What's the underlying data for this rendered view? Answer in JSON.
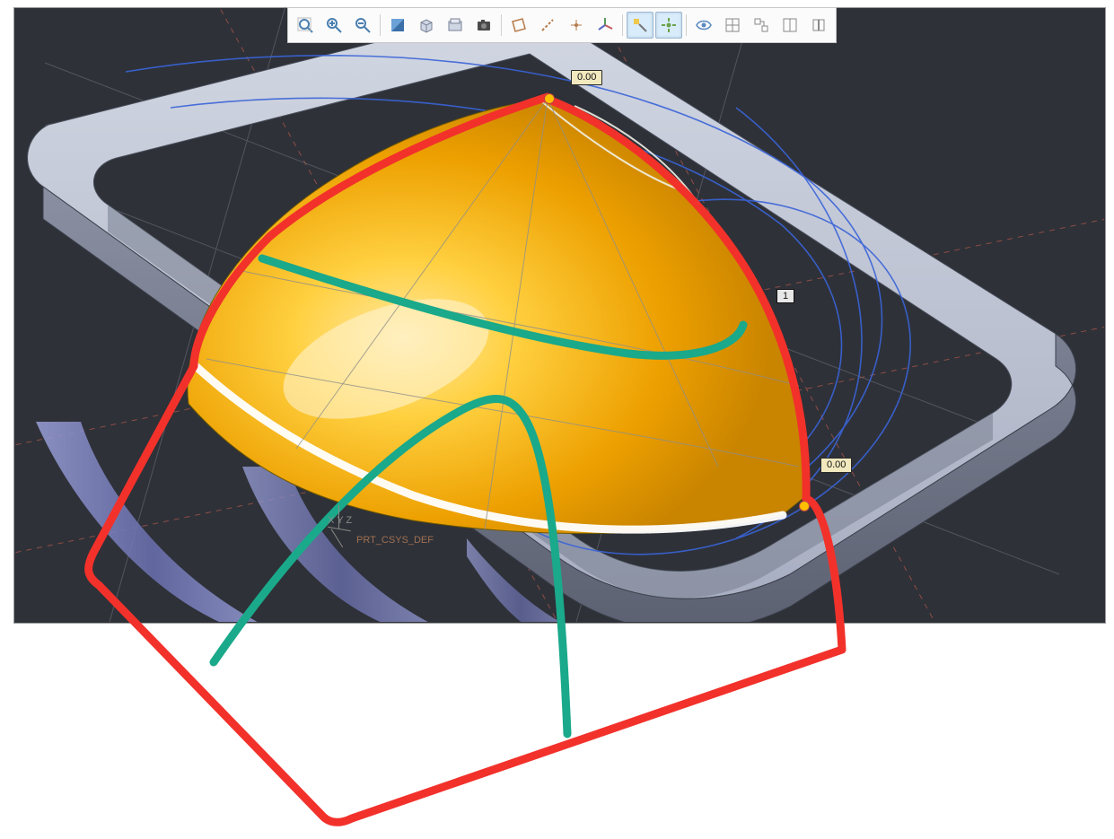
{
  "toolbar": {
    "buttons": [
      {
        "name": "refit",
        "tip": "Refit"
      },
      {
        "name": "zoom-in",
        "tip": "Zoom In"
      },
      {
        "name": "zoom-out",
        "tip": "Zoom Out"
      },
      {
        "name": "repaint",
        "tip": "Repaint"
      },
      {
        "name": "display-style",
        "tip": "Display Style"
      },
      {
        "name": "saved-views",
        "tip": "Saved Views"
      },
      {
        "name": "image-capture",
        "tip": "Render Region"
      },
      {
        "name": "datum-plane-display",
        "tip": "Datum Planes"
      },
      {
        "name": "datum-axis-display",
        "tip": "Datum Axes"
      },
      {
        "name": "datum-point-display",
        "tip": "Datum Points"
      },
      {
        "name": "csys-display",
        "tip": "Csys Display"
      },
      {
        "name": "annotation-display",
        "tip": "Annotations",
        "active": true
      },
      {
        "name": "spin-center",
        "tip": "Spin Center",
        "active": true
      },
      {
        "name": "perspective",
        "tip": "Perspective"
      },
      {
        "name": "layers",
        "tip": "Layers"
      },
      {
        "name": "model-tree",
        "tip": "Model Tree"
      },
      {
        "name": "window-tile",
        "tip": "Window"
      },
      {
        "name": "close-window",
        "tip": "Close Window"
      }
    ]
  },
  "dimensions": {
    "top": {
      "value": "0.00"
    },
    "right": {
      "value": "0.00"
    }
  },
  "index_badge": {
    "value": "1"
  },
  "csys": {
    "x": "X",
    "y": "Y",
    "z": "Z",
    "label": "PRT_CSYS_DEF"
  },
  "colors": {
    "surface": "#f0a400",
    "surface_hi": "#ffd36b",
    "ring": "#9ea6bd",
    "ring_top": "#c2c8d8",
    "ring_shadow": "#6a7080",
    "construction": "#c0574b",
    "curve": "#3a64d8",
    "highlight": "#ffffff",
    "annot_red": "#f2312b",
    "annot_teal": "#1aa98a",
    "bg": "#2e3138"
  }
}
